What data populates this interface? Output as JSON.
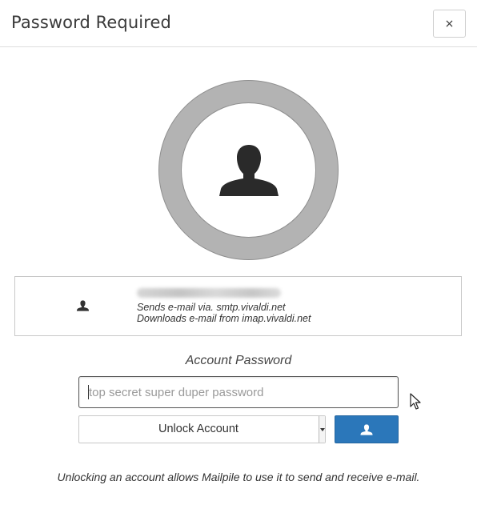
{
  "dialog": {
    "title": "Password Required",
    "close_label": "×"
  },
  "account": {
    "avatar_icon": "user-silhouette-icon",
    "card_icon": "user-icon",
    "email_visible": "",
    "sends_line": "Sends e-mail via. smtp.vivaldi.net",
    "downloads_line": "Downloads e-mail from imap.vivaldi.net"
  },
  "password": {
    "label": "Account Password",
    "placeholder": "top secret super duper password",
    "value": ""
  },
  "unlock": {
    "selected_option": "Unlock Account",
    "user_button_icon": "user-icon"
  },
  "footer": {
    "note": "Unlocking an account allows Mailpile to use it to send and receive e-mail."
  },
  "colors": {
    "primary_button": "#2b77ba",
    "ring": "#b3b3b3"
  }
}
